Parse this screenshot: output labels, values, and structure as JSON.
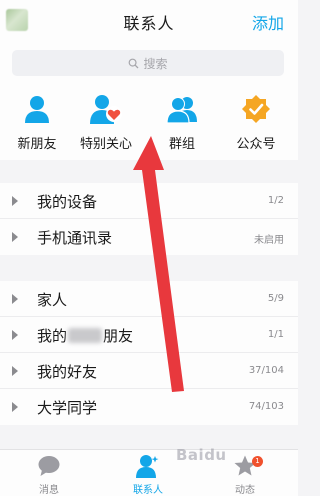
{
  "header": {
    "title": "联系人",
    "add_label": "添加"
  },
  "search": {
    "placeholder": "搜索",
    "icon": "search-icon"
  },
  "quick_actions": [
    {
      "label": "新朋友",
      "icon": "new-friend-icon"
    },
    {
      "label": "特别关心",
      "icon": "special-care-icon"
    },
    {
      "label": "群组",
      "icon": "groups-icon"
    },
    {
      "label": "公众号",
      "icon": "official-account-icon"
    }
  ],
  "device_rows": [
    {
      "name": "我的设备",
      "count": "1/2"
    },
    {
      "name": "手机通讯录",
      "count": "未启用"
    }
  ],
  "friend_groups": [
    {
      "name": "家人",
      "count": "5/9"
    },
    {
      "name_start": "我的",
      "name_end": "朋友",
      "count": "1/1"
    },
    {
      "name": "我的好友",
      "count": "37/104"
    },
    {
      "name": "大学同学",
      "count": "74/103"
    }
  ],
  "tabbar": [
    {
      "label": "消息",
      "icon": "message-icon"
    },
    {
      "label": "联系人",
      "icon": "contacts-icon"
    },
    {
      "label": "动态",
      "icon": "star-icon",
      "badge": "1"
    }
  ],
  "watermark": "Baidu",
  "colors": {
    "accent": "#13a6e8",
    "annotation_arrow": "#e8383d",
    "special_care_heart": "#f0513f",
    "official_badge": "#f5a623"
  }
}
